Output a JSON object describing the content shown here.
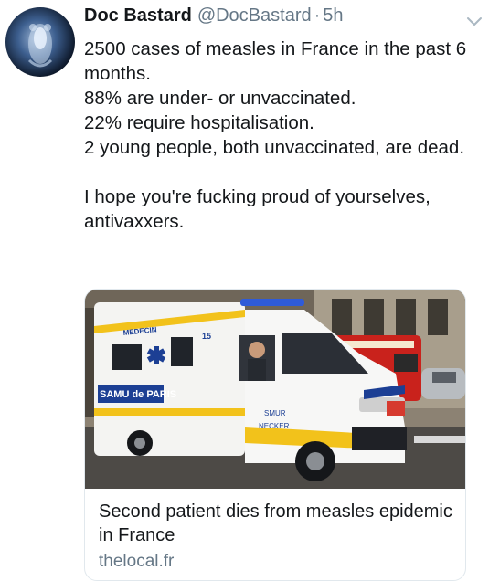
{
  "tweet": {
    "author_name": "Doc Bastard",
    "author_handle": "@DocBastard",
    "separator": "·",
    "time": "5h",
    "lines": [
      "2500 cases of measles in France in the past 6 months.",
      "88% are under- or unvaccinated.",
      "22% require hospitalisation.",
      "2 young people, both unvaccinated, are dead.",
      "I hope you're fucking proud of yourselves, antivaxxers."
    ]
  },
  "card": {
    "title": "Second patient dies from measles epidemic in France",
    "domain": "thelocal.fr",
    "image_text": {
      "medecin": "MEDECIN",
      "samu": "SAMU de PARIS",
      "smur": "SMUR",
      "necker": "NECKER",
      "number": "15"
    }
  },
  "icons": {
    "menu": "chevron-down-icon",
    "avatar": "xray-avatar"
  },
  "colors": {
    "text": "#14171a",
    "secondary": "#657786",
    "border": "#e1e8ed"
  }
}
